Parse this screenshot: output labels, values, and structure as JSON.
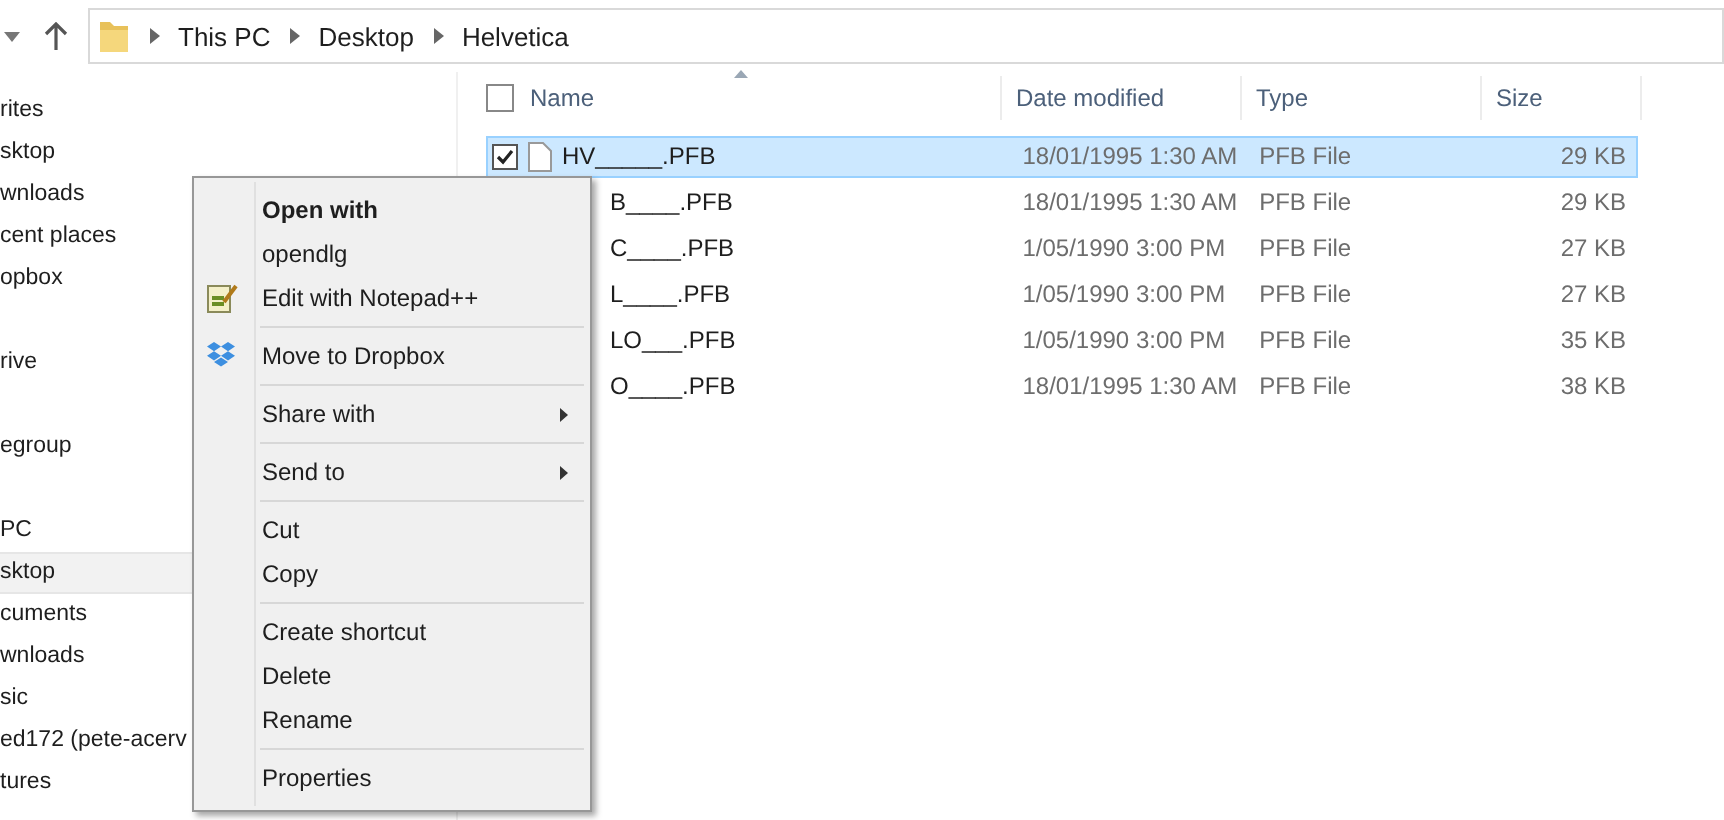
{
  "address_bar": {
    "crumbs": [
      "This PC",
      "Desktop",
      "Helvetica"
    ]
  },
  "nav_groups": [
    {
      "items": [
        {
          "label": "rites",
          "selected": false
        },
        {
          "label": "sktop",
          "selected": false
        },
        {
          "label": "wnloads",
          "selected": false
        },
        {
          "label": "cent places",
          "selected": false
        },
        {
          "label": "opbox",
          "selected": false
        }
      ]
    },
    {
      "items": [
        {
          "label": "rive",
          "selected": false
        }
      ]
    },
    {
      "items": [
        {
          "label": "egroup",
          "selected": false
        }
      ]
    },
    {
      "items": [
        {
          "label": "PC",
          "selected": false
        },
        {
          "label": "sktop",
          "selected": true
        },
        {
          "label": "cuments",
          "selected": false
        },
        {
          "label": "wnloads",
          "selected": false
        },
        {
          "label": "sic",
          "selected": false
        },
        {
          "label": "ed172 (pete-acerv",
          "selected": false
        },
        {
          "label": "tures",
          "selected": false
        }
      ]
    }
  ],
  "table": {
    "select_all_checked": false,
    "columns": [
      "Name",
      "Date modified",
      "Type",
      "Size"
    ],
    "rows": [
      {
        "name": "HV_____.PFB",
        "date": "18/01/1995 1:30 AM",
        "type": "PFB File",
        "size": "29 KB",
        "selected": true
      },
      {
        "name": "B____.PFB",
        "date": "18/01/1995 1:30 AM",
        "type": "PFB File",
        "size": "29 KB",
        "selected": false
      },
      {
        "name": "C____.PFB",
        "date": "1/05/1990 3:00 PM",
        "type": "PFB File",
        "size": "27 KB",
        "selected": false
      },
      {
        "name": "L____.PFB",
        "date": "1/05/1990 3:00 PM",
        "type": "PFB File",
        "size": "27 KB",
        "selected": false
      },
      {
        "name": "LO___.PFB",
        "date": "1/05/1990 3:00 PM",
        "type": "PFB File",
        "size": "35 KB",
        "selected": false
      },
      {
        "name": "O____.PFB",
        "date": "18/01/1995 1:30 AM",
        "type": "PFB File",
        "size": "38 KB",
        "selected": false
      }
    ]
  },
  "context_menu": {
    "sections": [
      {
        "items": [
          {
            "label": "Open with",
            "kind": "default"
          },
          {
            "label": "opendlg",
            "kind": "plain"
          },
          {
            "label": "Edit with Notepad++",
            "kind": "notepad"
          }
        ]
      },
      {
        "items": [
          {
            "label": "Move to Dropbox",
            "kind": "dropbox"
          }
        ]
      },
      {
        "items": [
          {
            "label": "Share with",
            "kind": "submenu"
          }
        ]
      },
      {
        "items": [
          {
            "label": "Send to",
            "kind": "submenu"
          }
        ]
      },
      {
        "items": [
          {
            "label": "Cut",
            "kind": "plain"
          },
          {
            "label": "Copy",
            "kind": "plain"
          }
        ]
      },
      {
        "items": [
          {
            "label": "Create shortcut",
            "kind": "plain"
          },
          {
            "label": "Delete",
            "kind": "plain"
          },
          {
            "label": "Rename",
            "kind": "plain"
          }
        ]
      },
      {
        "items": [
          {
            "label": "Properties",
            "kind": "plain"
          }
        ]
      }
    ]
  }
}
